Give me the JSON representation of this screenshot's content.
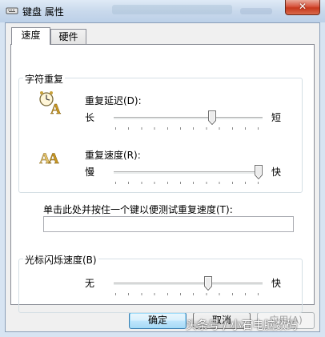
{
  "window": {
    "title": "键盘 属性",
    "close_label": "✕"
  },
  "tabs": [
    {
      "label": "速度",
      "active": true
    },
    {
      "label": "硬件",
      "active": false
    }
  ],
  "char_repeat": {
    "group_title": "字符重复",
    "repeat_delay": {
      "label": "重复延迟(D):",
      "min_label": "长",
      "max_label": "短",
      "value_fraction": 0.67
    },
    "repeat_rate": {
      "label": "重复速度(R):",
      "min_label": "慢",
      "max_label": "快",
      "value_fraction": 1.0
    },
    "test_label": "单击此处并按住一个键以便测试重复速度(T):",
    "test_value": ""
  },
  "cursor_blink": {
    "group_title": "光标闪烁速度(B)",
    "min_label": "无",
    "max_label": "快",
    "value_fraction": 0.64
  },
  "buttons": {
    "ok": "确定",
    "cancel": "取消",
    "apply": "应用(A)"
  },
  "watermark": "头条号 / 小石电脑数码"
}
